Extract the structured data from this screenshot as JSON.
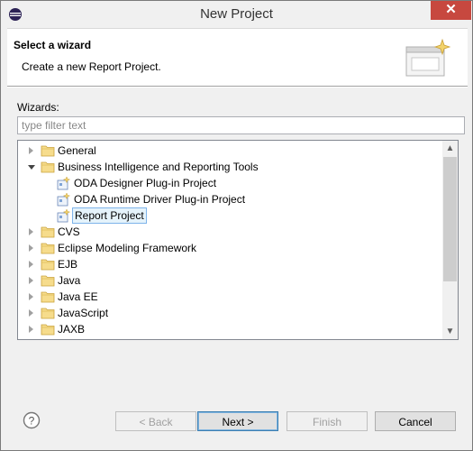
{
  "window": {
    "title": "New Project"
  },
  "banner": {
    "title": "Select a wizard",
    "description": "Create a new Report Project."
  },
  "wizards_label": "Wizards:",
  "filter": {
    "placeholder": "type filter text",
    "value": ""
  },
  "tree": {
    "items": [
      {
        "label": "General",
        "type": "folder",
        "expanded": false,
        "level": 0
      },
      {
        "label": "Business Intelligence and Reporting Tools",
        "type": "folder",
        "expanded": true,
        "level": 0
      },
      {
        "label": "ODA Designer Plug-in Project",
        "type": "project",
        "level": 1
      },
      {
        "label": "ODA Runtime Driver Plug-in Project",
        "type": "project",
        "level": 1
      },
      {
        "label": "Report Project",
        "type": "project",
        "level": 1,
        "selected": true
      },
      {
        "label": "CVS",
        "type": "folder",
        "expanded": false,
        "level": 0
      },
      {
        "label": "Eclipse Modeling Framework",
        "type": "folder",
        "expanded": false,
        "level": 0
      },
      {
        "label": "EJB",
        "type": "folder",
        "expanded": false,
        "level": 0
      },
      {
        "label": "Java",
        "type": "folder",
        "expanded": false,
        "level": 0
      },
      {
        "label": "Java EE",
        "type": "folder",
        "expanded": false,
        "level": 0
      },
      {
        "label": "JavaScript",
        "type": "folder",
        "expanded": false,
        "level": 0
      },
      {
        "label": "JAXB",
        "type": "folder",
        "expanded": false,
        "level": 0
      }
    ]
  },
  "buttons": {
    "back": "< Back",
    "next": "Next >",
    "finish": "Finish",
    "cancel": "Cancel"
  },
  "colors": {
    "close": "#c7483f",
    "selection": "#e5f3fb",
    "folder": "#e8c86a"
  }
}
